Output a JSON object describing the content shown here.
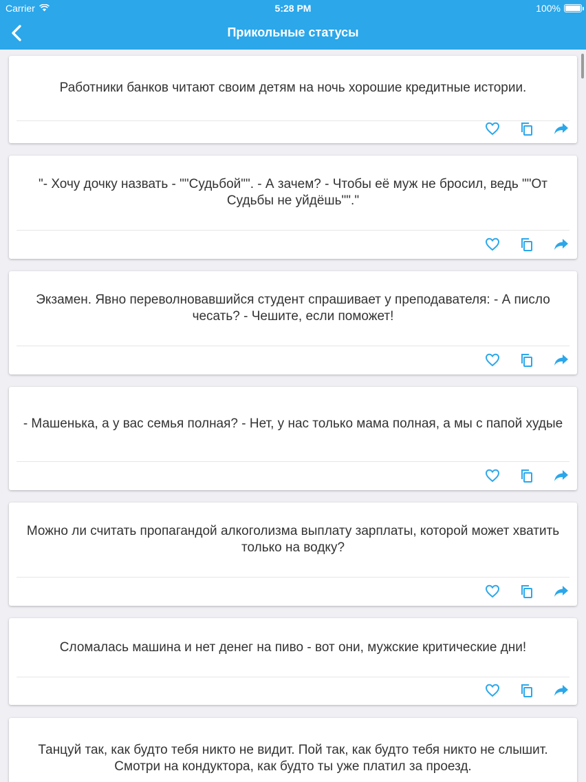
{
  "status_bar": {
    "carrier": "Carrier",
    "time": "5:28 PM",
    "battery": "100%"
  },
  "nav": {
    "title": "Прикольные статусы",
    "back_icon": "chevron-left-icon"
  },
  "colors": {
    "accent": "#2ba7ea",
    "background": "#efeff4",
    "card": "#ffffff",
    "text": "#333333"
  },
  "actions": {
    "like_icon": "heart-icon",
    "copy_icon": "copy-icon",
    "share_icon": "share-icon"
  },
  "statuses": [
    {
      "text": "Работники банков читают своим детям на ночь хорошие кредитные истории."
    },
    {
      "text": "\"- Хочу дочку назвать - \"\"Судьбой\"\". - А зачем? - Чтобы её муж не бросил, ведь \"\"От Судьбы не уйдёшь\"\".\""
    },
    {
      "text": "Экзамен. Явно переволновавшийся студент спрашивает у преподавателя: - А писло чесать? - Чешите, если поможет!"
    },
    {
      "text": "- Машенька, а у вас семья полная? - Нет, у нас только мама полная, а мы с папой худые"
    },
    {
      "text": "Можно ли считать пропагандой алкоголизма выплату зарплаты, которой может хватить только на водку?"
    },
    {
      "text": "Сломалась машина и нет денег на пиво - вот они, мужские критические дни!"
    },
    {
      "text": "Танцуй так, как будто тебя никто не видит. Пой так, как будто тебя никто не слышит. Смотри на кондуктора, как будто ты уже платил за проезд."
    }
  ]
}
